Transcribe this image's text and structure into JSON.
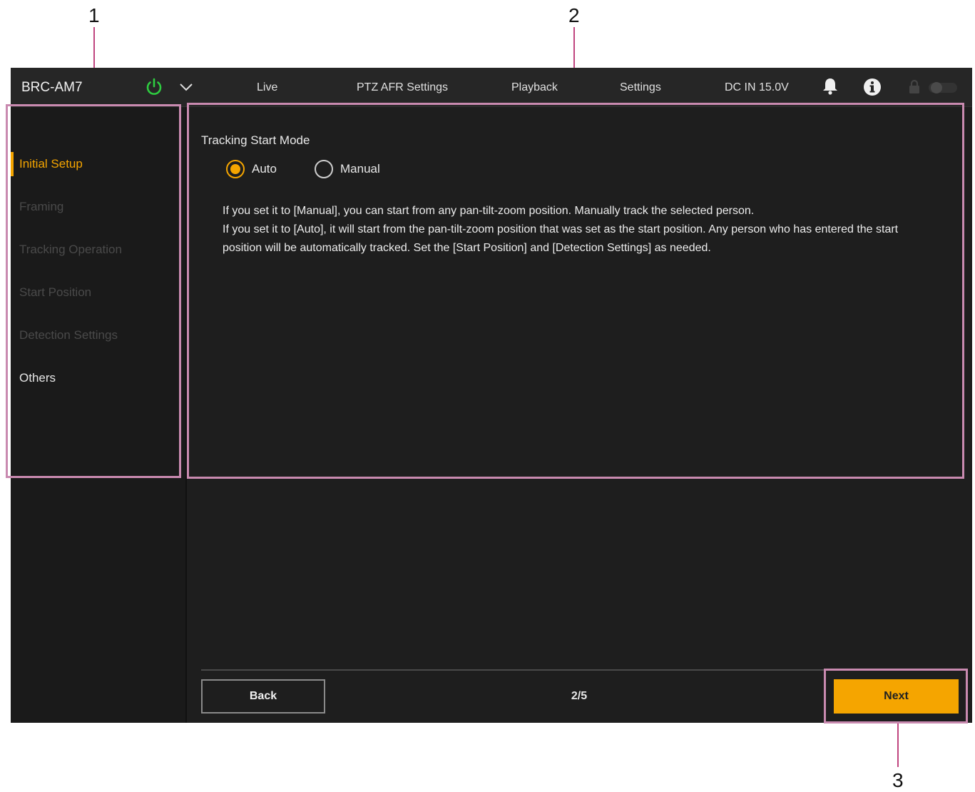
{
  "callouts": [
    "1",
    "2",
    "3"
  ],
  "header": {
    "brand": "BRC-AM7",
    "nav": [
      "Live",
      "PTZ AFR Settings",
      "Playback",
      "Settings"
    ],
    "power_status": "DC IN 15.0V",
    "icons": [
      "power-icon",
      "chevron-down-icon",
      "bell-icon",
      "info-icon",
      "lock-icon",
      "toggle-switch-icon"
    ]
  },
  "sidebar": {
    "items": [
      {
        "label": "Initial Setup",
        "state": "active"
      },
      {
        "label": "Framing",
        "state": "disabled"
      },
      {
        "label": "Tracking Operation",
        "state": "disabled"
      },
      {
        "label": "Start Position",
        "state": "disabled"
      },
      {
        "label": "Detection Settings",
        "state": "disabled"
      },
      {
        "label": "Others",
        "state": "normal"
      }
    ]
  },
  "main": {
    "mode_label": "Tracking Start Mode",
    "options": [
      {
        "label": "Auto",
        "selected": true
      },
      {
        "label": "Manual",
        "selected": false
      }
    ],
    "description": [
      "If you set it to [Manual], you can start from any pan-tilt-zoom position. Manually track the selected person.",
      "If you set it to [Auto], it will start from the pan-tilt-zoom position that was set as the start position. Any person who has entered the start position will be automatically tracked. Set the [Start Position] and [Detection Settings] as needed."
    ]
  },
  "footer": {
    "back_label": "Back",
    "page_indicator": "2/5",
    "next_label": "Next"
  },
  "colors": {
    "accent": "#f5a500",
    "power_green": "#2ecc40",
    "background": "#1e1e1e",
    "highlight": "#c98ab0"
  }
}
